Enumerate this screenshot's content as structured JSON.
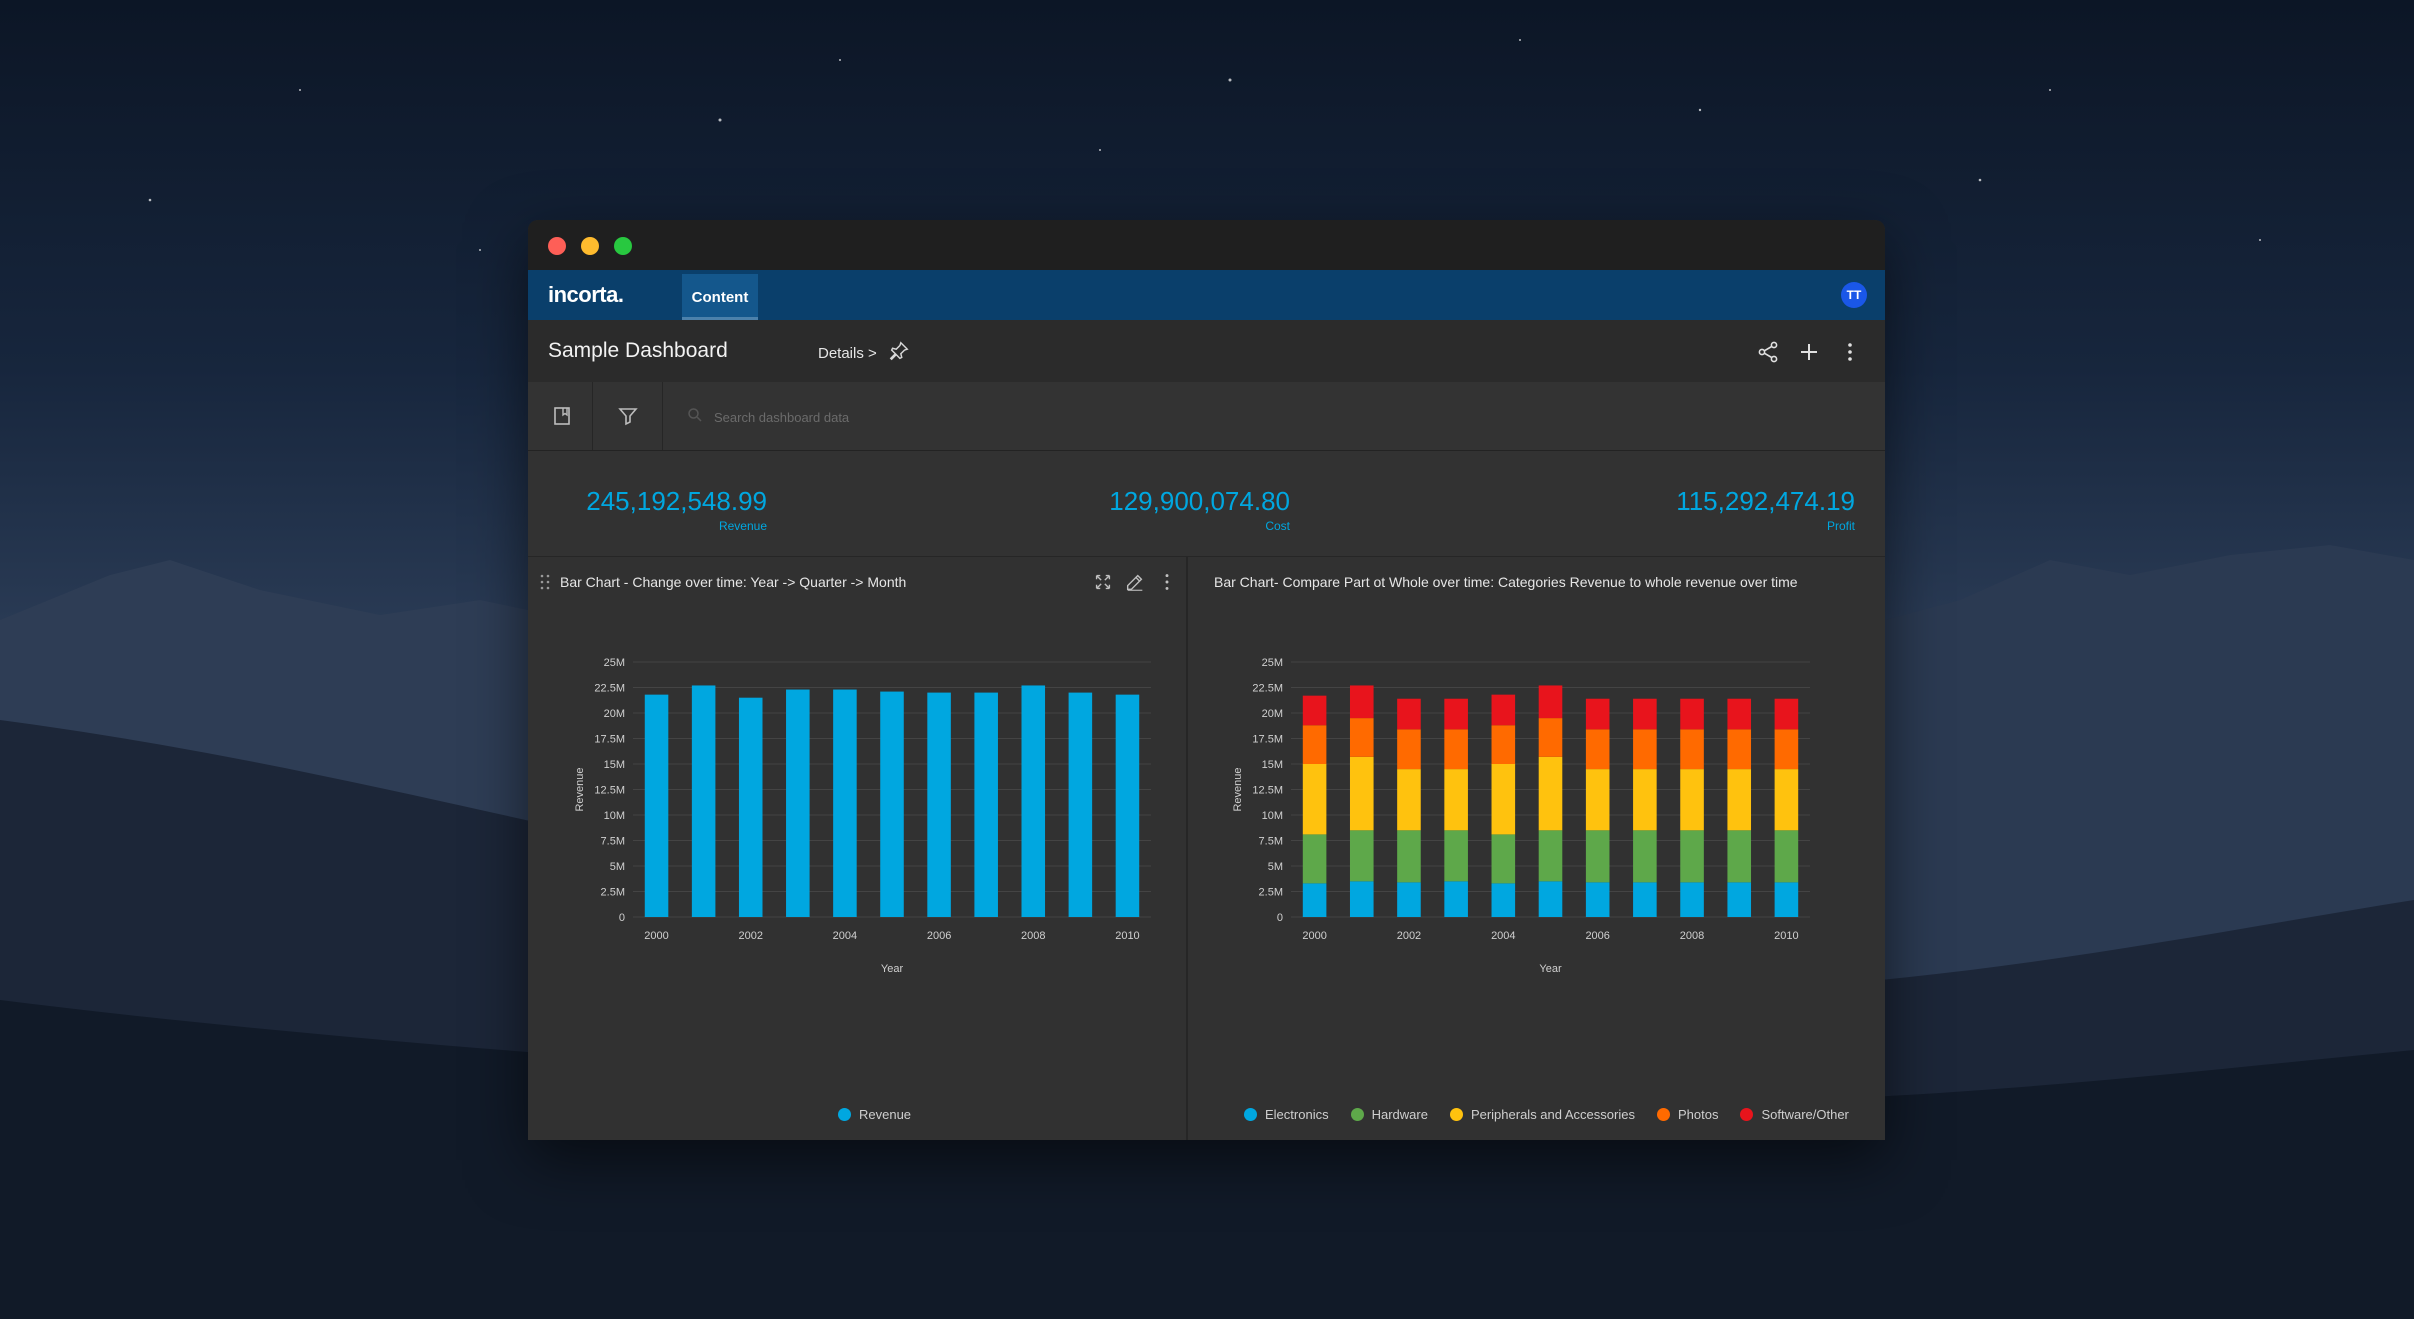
{
  "app": {
    "logo": "incorta.",
    "tab": "Content",
    "user_initials": "TT"
  },
  "header": {
    "title": "Sample Dashboard",
    "details": "Details >"
  },
  "toolbar": {
    "search_placeholder": "Search dashboard data"
  },
  "kpis": [
    {
      "value": "245,192,548.99",
      "label": "Revenue"
    },
    {
      "value": "129,900,074.80",
      "label": "Cost"
    },
    {
      "value": "115,292,474.19",
      "label": "Profit"
    }
  ],
  "colors": {
    "accent": "#00a7e0",
    "appbar": "#0a3f6b",
    "electronics": "#00a7e0",
    "hardware": "#5ea84a",
    "peripherals": "#ffc20e",
    "photos": "#ff6a00",
    "software": "#e8141c"
  },
  "icons": [
    "pin-icon",
    "share-icon",
    "plus-icon",
    "more-icon",
    "bookmark-icon",
    "filter-icon",
    "search-icon",
    "expand-icon",
    "edit-icon",
    "drag-icon"
  ],
  "chart_data": [
    {
      "type": "bar",
      "title": "Bar Chart - Change over time: Year -> Quarter -> Month",
      "xlabel": "Year",
      "ylabel": "Revenue",
      "ylim": [
        0,
        25000000
      ],
      "yticks": [
        "0",
        "2.5M",
        "5M",
        "7.5M",
        "10M",
        "12.5M",
        "15M",
        "17.5M",
        "20M",
        "22.5M",
        "25M"
      ],
      "categories": [
        "2000",
        "2001",
        "2002",
        "2003",
        "2004",
        "2005",
        "2006",
        "2007",
        "2008",
        "2009",
        "2010"
      ],
      "x_tick_labels": [
        "2000",
        "2002",
        "2004",
        "2006",
        "2008",
        "2010"
      ],
      "series": [
        {
          "name": "Revenue",
          "color": "#00a7e0",
          "values": [
            21800000,
            22700000,
            21500000,
            22300000,
            22300000,
            22100000,
            22000000,
            22000000,
            22700000,
            22000000,
            21800000
          ]
        }
      ],
      "grid": true,
      "legend": "bottom"
    },
    {
      "type": "bar",
      "stacked": true,
      "title": "Bar Chart- Compare Part ot Whole over time: Categories Revenue to whole revenue over time",
      "xlabel": "Year",
      "ylabel": "Revenue",
      "ylim": [
        0,
        25000000
      ],
      "yticks": [
        "0",
        "2.5M",
        "5M",
        "7.5M",
        "10M",
        "12.5M",
        "15M",
        "17.5M",
        "20M",
        "22.5M",
        "25M"
      ],
      "categories": [
        "2000",
        "2001",
        "2002",
        "2003",
        "2004",
        "2005",
        "2006",
        "2007",
        "2008",
        "2009",
        "2010"
      ],
      "x_tick_labels": [
        "2000",
        "2002",
        "2004",
        "2006",
        "2008",
        "2010"
      ],
      "series": [
        {
          "name": "Electronics",
          "color": "#00a7e0",
          "values": [
            3300000,
            3500000,
            3400000,
            3500000,
            3300000,
            3500000,
            3400000,
            3400000,
            3400000,
            3400000,
            3400000
          ]
        },
        {
          "name": "Hardware",
          "color": "#5ea84a",
          "values": [
            4800000,
            5000000,
            5100000,
            5000000,
            4800000,
            5000000,
            5100000,
            5100000,
            5100000,
            5100000,
            5100000
          ]
        },
        {
          "name": "Peripherals and Accessories",
          "color": "#ffc20e",
          "values": [
            6900000,
            7200000,
            6000000,
            6000000,
            6900000,
            7200000,
            6000000,
            6000000,
            6000000,
            6000000,
            6000000
          ]
        },
        {
          "name": "Photos",
          "color": "#ff6a00",
          "values": [
            3800000,
            3800000,
            3900000,
            3900000,
            3800000,
            3800000,
            3900000,
            3900000,
            3900000,
            3900000,
            3900000
          ]
        },
        {
          "name": "Software/Other",
          "color": "#e8141c",
          "values": [
            2900000,
            3200000,
            3000000,
            3000000,
            3000000,
            3200000,
            3000000,
            3000000,
            3000000,
            3000000,
            3000000
          ]
        }
      ],
      "grid": true,
      "legend": "bottom"
    }
  ]
}
